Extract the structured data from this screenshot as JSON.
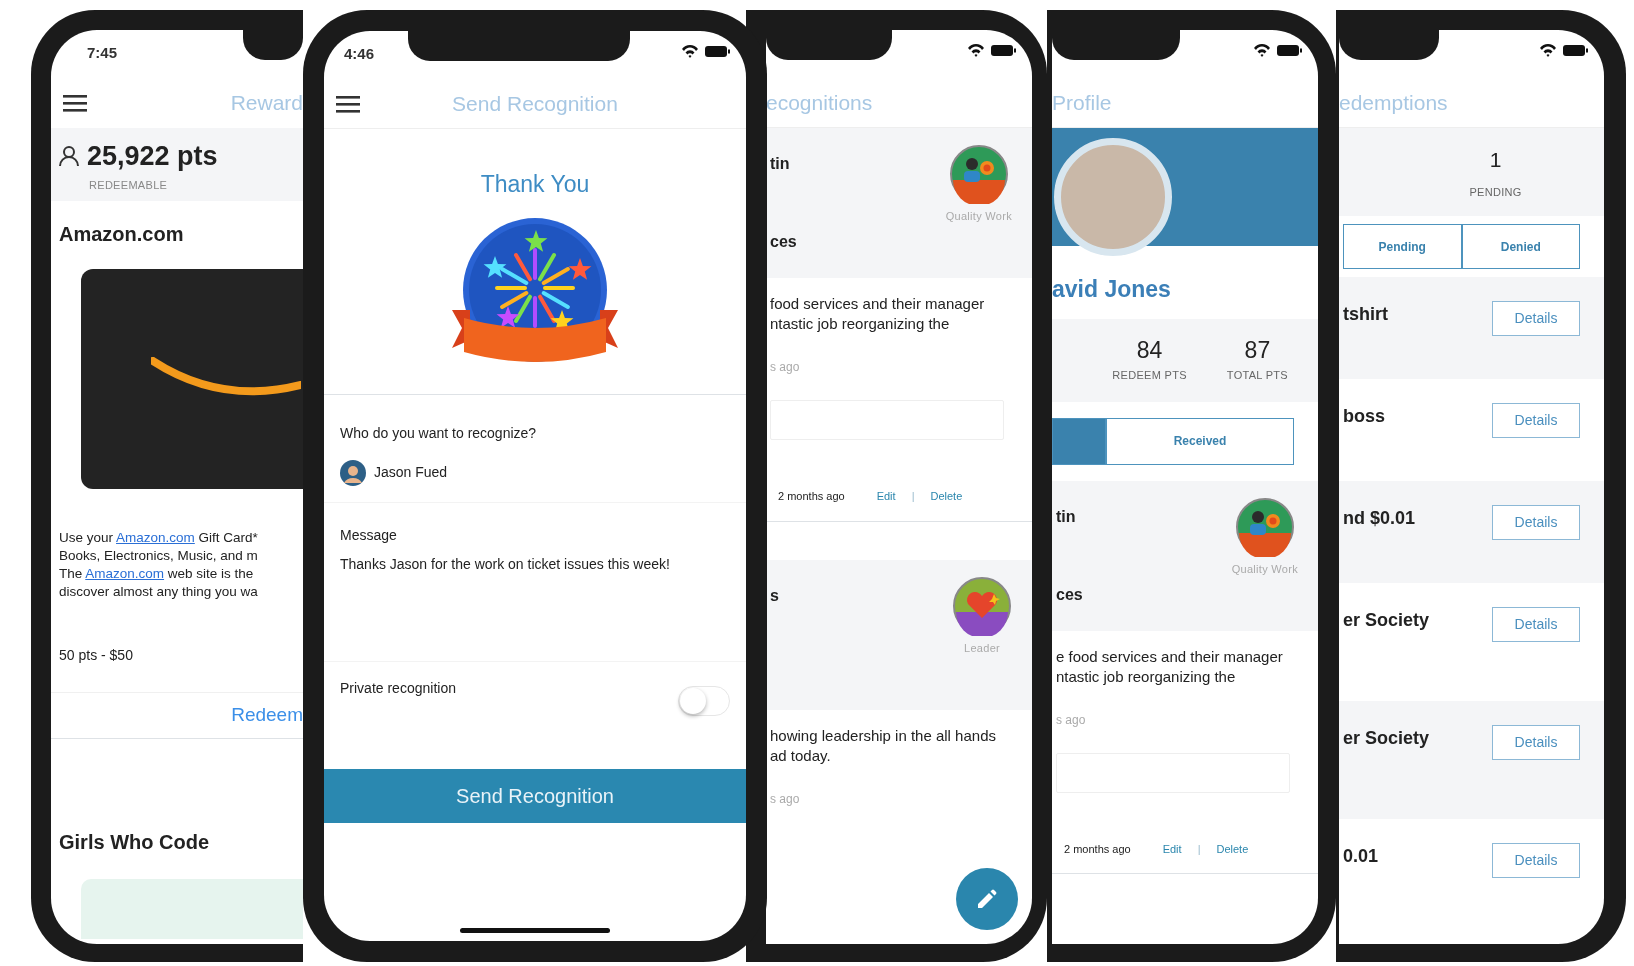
{
  "phones": [
    {
      "kind": "rewards",
      "time": "7:45",
      "title": "Reward",
      "points": "25,922 pts",
      "points_label": "REDEEMABLE",
      "rewards": [
        {
          "name": "Amazon.com",
          "description": [
            [
              {
                "text": "Use your ",
                "link": false
              },
              {
                "text": "Amazon.com",
                "link": true
              },
              {
                "text": " Gift Card*",
                "link": false
              }
            ],
            [
              {
                "text": "Books, Electronics, Music, and m",
                "link": false
              }
            ],
            [
              {
                "text": "The ",
                "link": false
              },
              {
                "text": "Amazon.com",
                "link": true
              },
              {
                "text": " web site is the",
                "link": false
              }
            ],
            [
              {
                "text": "discover almost any thing you wa",
                "link": false
              }
            ]
          ],
          "price": "50 pts - $50",
          "action": "Redeem"
        },
        {
          "name": "Girls Who Code"
        }
      ]
    },
    {
      "kind": "send",
      "time": "4:46",
      "title": "Send Recognition",
      "heading": "Thank You",
      "recipient_label": "Who do you want to recognize?",
      "recipient": "Jason Fued",
      "message_label": "Message",
      "message": "Thanks Jason for the work on ticket issues this week!",
      "private": {
        "label": "Private recognition",
        "on": false
      },
      "button": "Send Recognition"
    },
    {
      "kind": "feed",
      "title": "ecognitions",
      "cards": [
        {
          "name": "tin",
          "subtitle": "ces",
          "badge": "Quality Work",
          "lines": [
            "food services and their manager",
            "ntastic job reorganizing the"
          ],
          "ago": "s ago",
          "time": "2 months ago",
          "edit": "Edit",
          "separator": "|",
          "delete": "Delete"
        },
        {
          "name": "s",
          "badge": "Leader",
          "lines": [
            "howing leadership in the all hands",
            "ad today."
          ],
          "ago": "s ago"
        }
      ]
    },
    {
      "kind": "profile",
      "title": "Profile",
      "name": "avid Jones",
      "stats": [
        {
          "value": "84",
          "label": "REDEEM PTS"
        },
        {
          "value": "87",
          "label": "TOTAL PTS"
        }
      ],
      "tabs": [
        {
          "selected": true
        },
        {
          "label": "Received",
          "selected": false
        }
      ],
      "cards": [
        {
          "name": "tin",
          "subtitle": "ces",
          "badge": "Quality Work",
          "lines": [
            "e food services and their manager",
            "ntastic job reorganizing the"
          ],
          "ago": "s ago",
          "time": "2 months ago",
          "edit": "Edit",
          "separator": "|",
          "delete": "Delete"
        }
      ]
    },
    {
      "kind": "redemptions",
      "title": "edemptions",
      "stats": [
        {
          "value": "1",
          "label": "PENDING"
        }
      ],
      "tabs": [
        {
          "label": "Pending",
          "selected": false
        },
        {
          "label": "Denied",
          "selected": false
        }
      ],
      "rows": [
        {
          "name": "tshirt",
          "action": "Details"
        },
        {
          "name": "boss",
          "action": "Details"
        },
        {
          "name": "nd $0.01",
          "action": "Details"
        },
        {
          "name": "er Society",
          "action": "Details"
        },
        {
          "name": "er Society",
          "action": "Details"
        },
        {
          "name": "0.01",
          "action": "Details"
        }
      ]
    }
  ]
}
